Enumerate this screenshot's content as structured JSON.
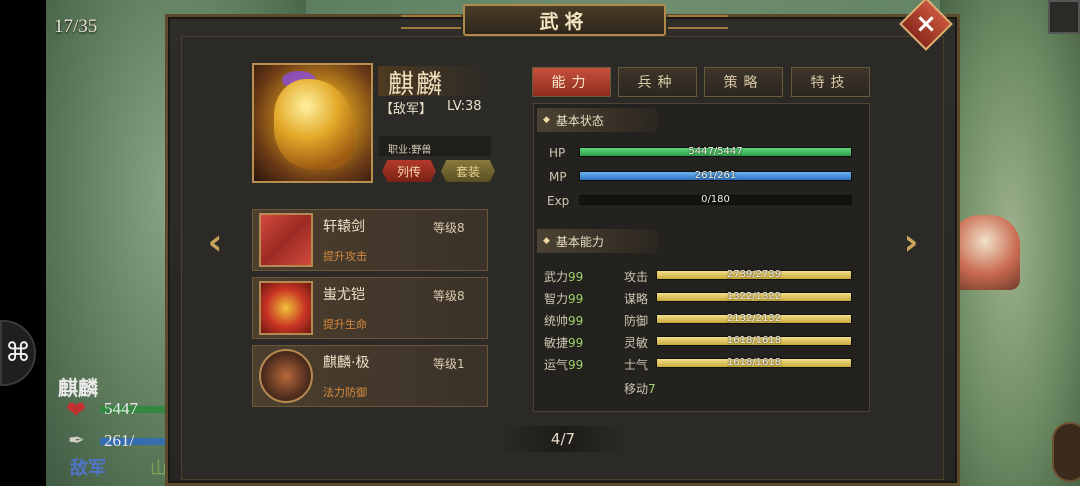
{
  "background": {
    "counter": "17/35",
    "unit_name": "麒麟",
    "hp_text": "5447",
    "mp_text": "261/",
    "side": "敌军",
    "terrain": "山"
  },
  "window": {
    "title": "武将",
    "close_label": "×",
    "prev_label": "‹",
    "next_label": "›"
  },
  "general": {
    "name": "麒麟",
    "side_tag": "【敌军】",
    "level_label": "LV:38",
    "job_label": "职业:野兽",
    "bio_button": "列传",
    "set_button": "套装"
  },
  "equipment": [
    {
      "name": "轩辕剑",
      "level": "等级8",
      "desc": "提升攻击"
    },
    {
      "name": "蚩尤铠",
      "level": "等级8",
      "desc": "提升生命"
    },
    {
      "name": "麒麟·极",
      "level": "等级1",
      "desc": "法力防御"
    }
  ],
  "page_indicator": "4/7",
  "tabs": [
    {
      "label": "能力",
      "active": true
    },
    {
      "label": "兵种",
      "active": false
    },
    {
      "label": "策略",
      "active": false
    },
    {
      "label": "特技",
      "active": false
    }
  ],
  "status_section": {
    "title": "基本状态",
    "hp": {
      "label": "HP",
      "text": "5447/5447",
      "ratio": 1.0
    },
    "mp": {
      "label": "MP",
      "text": "261/261",
      "ratio": 1.0
    },
    "exp": {
      "label": "Exp",
      "text": "0/180",
      "ratio": 0.0
    }
  },
  "ability_section": {
    "title": "基本能力",
    "base": [
      {
        "label": "武力",
        "value": "99"
      },
      {
        "label": "智力",
        "value": "99"
      },
      {
        "label": "统帅",
        "value": "99"
      },
      {
        "label": "敏捷",
        "value": "99"
      },
      {
        "label": "运气",
        "value": "99"
      }
    ],
    "derived": [
      {
        "label": "攻击",
        "text": "2739/2739",
        "ratio": 1.0
      },
      {
        "label": "谋略",
        "text": "1322/1322",
        "ratio": 1.0
      },
      {
        "label": "防御",
        "text": "2132/2132",
        "ratio": 1.0
      },
      {
        "label": "灵敏",
        "text": "1618/1618",
        "ratio": 1.0
      },
      {
        "label": "士气",
        "text": "1618/1618",
        "ratio": 1.0
      }
    ],
    "move_label": "移动",
    "move_value": "7"
  },
  "colors": {
    "accent_red": "#c5503b",
    "hp_green": "#2f9d4b",
    "mp_blue": "#2d74c5",
    "gold": "#c9a83a"
  }
}
